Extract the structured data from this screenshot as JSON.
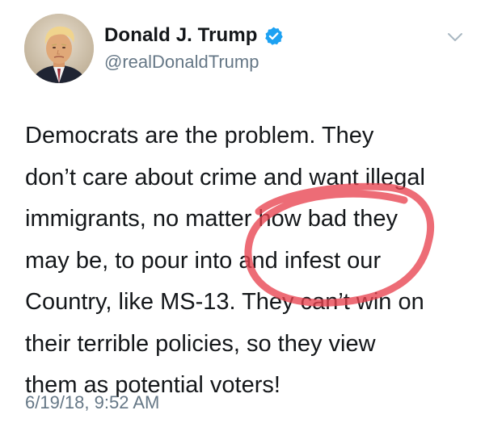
{
  "tweet": {
    "author": {
      "display_name": "Donald J. Trump",
      "handle": "@realDonaldTrump",
      "verified": true,
      "avatar_icon": "profile-photo"
    },
    "text_lines": [
      "Democrats are the problem. They",
      "don’t care about crime and want illegal",
      "immigrants, no matter how bad they",
      "may be, to pour into and infest our",
      "Country, like MS-13. They can’t win on",
      "their terrible policies, so they view",
      "them as potential voters!"
    ],
    "timestamp": "6/19/18, 9:52 AM",
    "menu_icon": "chevron-down-icon"
  },
  "annotation": {
    "shape": "hand-drawn circle",
    "color": "#e8434f"
  },
  "colors": {
    "text": "#14171a",
    "secondary": "#657786",
    "verified": "#1da1f2"
  }
}
